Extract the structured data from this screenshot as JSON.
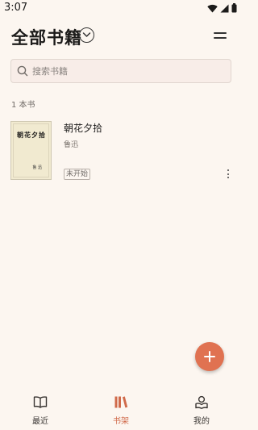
{
  "status_bar": {
    "time": "3:07"
  },
  "header": {
    "title": "全部书籍"
  },
  "search": {
    "placeholder": "搜索书籍"
  },
  "library": {
    "count_text": "1 本书",
    "books": [
      {
        "title": "朝花夕拾",
        "author": "鲁迅",
        "status": "未开始",
        "cover_title": "朝花夕拾",
        "cover_author": "鲁 迅"
      }
    ]
  },
  "fab": {
    "icon": "plus-icon"
  },
  "bottom_nav": {
    "items": [
      {
        "label": "最近",
        "icon": "book-open-icon",
        "active": false
      },
      {
        "label": "书架",
        "icon": "bookshelf-icon",
        "active": true
      },
      {
        "label": "我的",
        "icon": "profile-icon",
        "active": false
      }
    ]
  },
  "colors": {
    "background": "#fcf6f0",
    "accent": "#d06a4a",
    "fab": "#e07251",
    "search_background": "#f8ede8"
  }
}
